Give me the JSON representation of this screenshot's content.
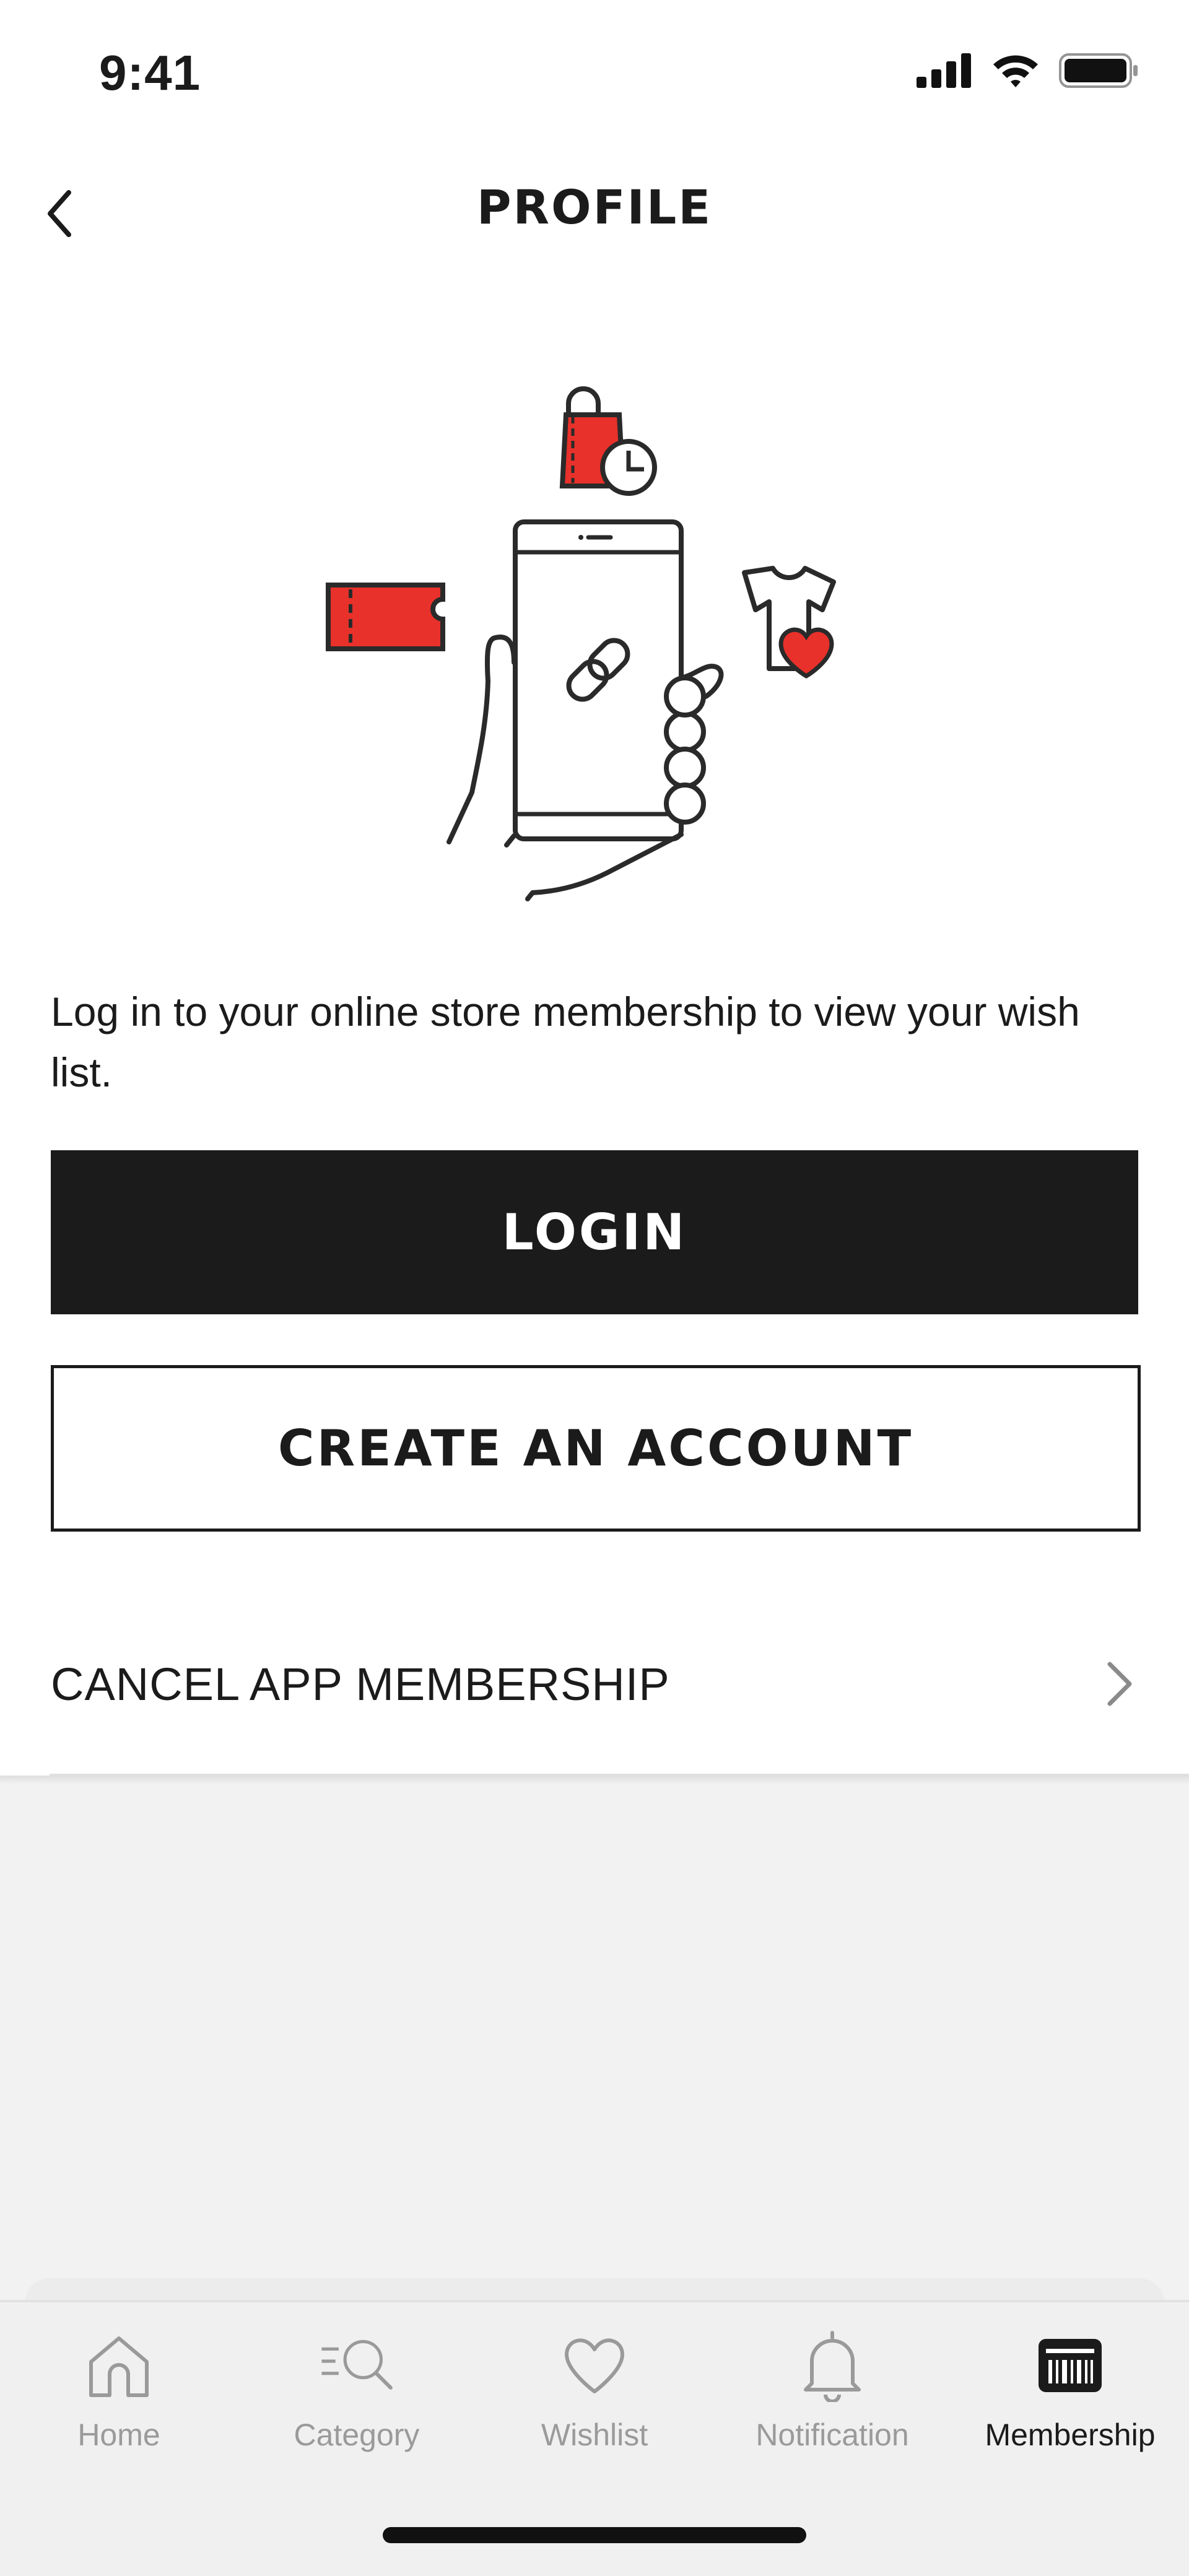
{
  "status_bar": {
    "time": "9:41",
    "icons": [
      "signal-icon",
      "wifi-icon",
      "battery-icon"
    ]
  },
  "nav": {
    "title": "PROFILE",
    "back_icon": "chevron-left-icon"
  },
  "hero": {
    "illustration": "phone-link-illustration",
    "accent_color": "#e8312a"
  },
  "content": {
    "prompt": "Log in to your online store membership to view your wish list.",
    "login_label": "LOGIN",
    "create_account_label": "CREATE AN ACCOUNT",
    "cancel_membership_label": "CANCEL APP MEMBERSHIP"
  },
  "tabbar": {
    "active": "Membership",
    "tabs": [
      {
        "label": "Home",
        "icon": "home-icon"
      },
      {
        "label": "Category",
        "icon": "category-search-icon"
      },
      {
        "label": "Wishlist",
        "icon": "heart-icon"
      },
      {
        "label": "Notification",
        "icon": "bell-icon"
      },
      {
        "label": "Membership",
        "icon": "membership-card-icon"
      }
    ]
  },
  "colors": {
    "primary": "#1b1b1b",
    "accent": "#e8312a",
    "inactive": "#9a9a9a",
    "background": "#f2f2f2"
  }
}
